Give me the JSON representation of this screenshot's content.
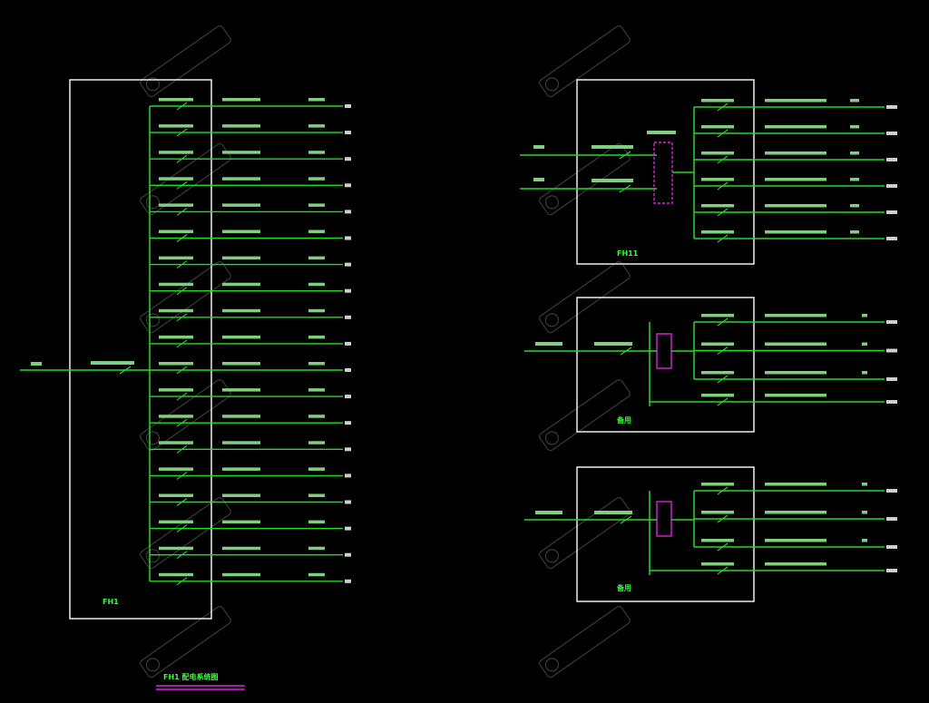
{
  "colors": {
    "background": "#000000",
    "line": "#22dd22",
    "frame": "#ffffff",
    "device": "#dd22dd",
    "text": "#8dff8d",
    "watermark": "#3a3a3a"
  },
  "panel_main": {
    "title": "FH1",
    "feeder_count": 19
  },
  "panel_top_right": {
    "title": "FH11",
    "incomer_count": 2,
    "feeder_count": 6
  },
  "panel_mid_right": {
    "title": "备用",
    "feeder_count": 4
  },
  "panel_bot_right": {
    "title": "备用",
    "feeder_count": 4
  },
  "legend": {
    "title": "FH1 配电系统图"
  },
  "watermark": {
    "icon": "brand-logo-icon"
  }
}
